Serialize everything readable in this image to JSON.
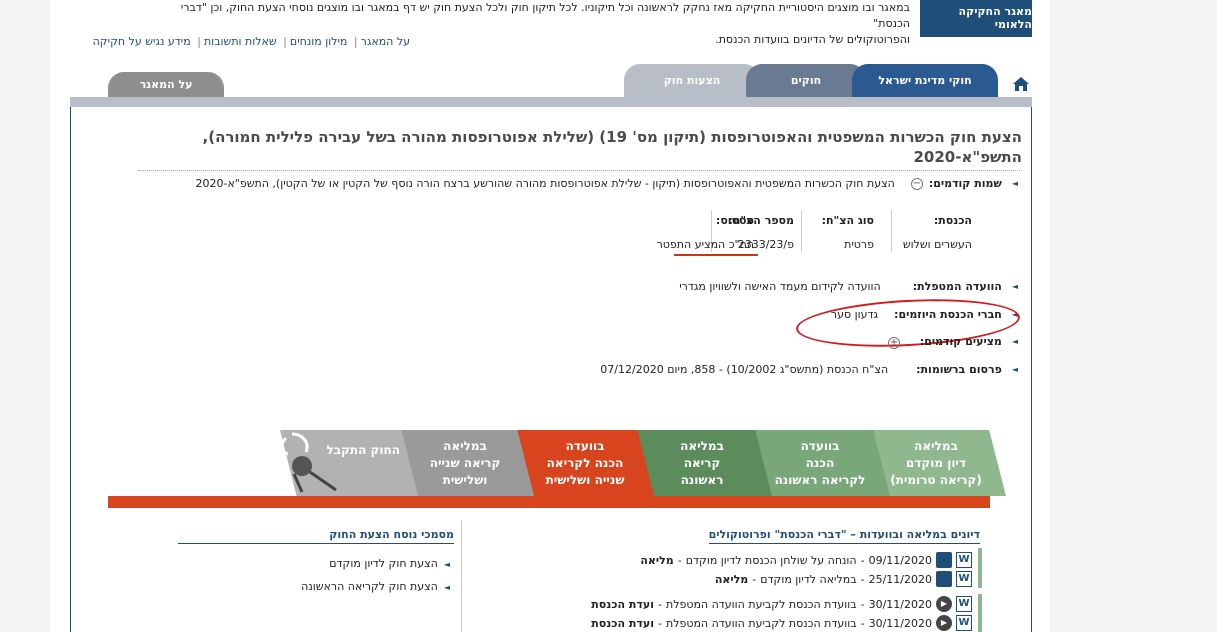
{
  "header": {
    "intro_line1": "במאגר ובו מוצגים היסטוריית החקיקה מאז נחקק לראשונה וכל תיקוניו. לכל תיקון חוק ולכל הצעת חוק יש דף במאגר ובו מוצגים נוסחי הצעת החוק, וכן \"דברי הכנסת\"",
    "intro_line2": "והפרוטוקולים של הדיונים בוועדות הכנסת.",
    "logo_text": "מאגר החקיקה הלאומי",
    "links": [
      "על המאגר",
      "מילון מונחים",
      "שאלות ותשובות",
      "מידע נגיש על חקיקה"
    ]
  },
  "tabs": {
    "laws_state": "חוקי מדינת ישראל",
    "laws": "חוקים",
    "bills": "הצעות חוק",
    "about": "על המאגר"
  },
  "bill": {
    "title_line1": "הצעת חוק הכשרות המשפטית והאפוטרופסות (תיקון מס' 19) (שלילת אפוטרופסות מהורה בשל עבירה פלילית חמורה),",
    "title_line2": "התשפ\"א-2020",
    "prev_names_label": "שמות קודמים:",
    "prev_names_value": "הצעת חוק הכשרות המשפטית והאפוטרופסות (תיקון - שלילת אפוטרופסות מהורה שהורשע ברצח הורה נוסף של הקטין או של הקטין), התשפ\"א-2020",
    "info": {
      "knesset_label": "הכנסת:",
      "knesset_value": "העשרים ושלוש",
      "type_label": "סוג הצ\"ח:",
      "type_value": "פרטית",
      "number_label": "מספר הצ\"ח:",
      "number_value": "פ/2333/23",
      "status_label": "סטטוס:",
      "status_value": "הח\"כ המציע התפטר"
    },
    "committee_label": "הוועדה המטפלת:",
    "committee_value": "הוועדה לקידום מעמד האישה ולשוויון מגדרי",
    "initiators_label": "חברי הכנסת היוזמים:",
    "initiators_value": "גדעון סער",
    "proposers_label": "מציעים קודמים:",
    "publication_label": "פרסום ברשומות:",
    "publication_value": "הצ\"ח הכנסת (מתשס\"ג 10/2002) - 858, מיום 07/12/2020"
  },
  "stages": [
    {
      "line1": "במליאה",
      "line2": "דיון מוקדם",
      "line3": "(קריאה טרומית)"
    },
    {
      "line1": "בוועדה",
      "line2": "הכנה",
      "line3": "לקריאה ראשונה"
    },
    {
      "line1": "במליאה",
      "line2": "קריאה",
      "line3": "ראשונה"
    },
    {
      "line1": "בוועדה",
      "line2": "הכנה לקריאה",
      "line3": "שנייה ושלישית"
    },
    {
      "line1": "במליאה",
      "line2": "קריאה שנייה",
      "line3": "ושלישית"
    },
    {
      "line1": "החוק התקבל",
      "line2": "",
      "line3": ""
    }
  ],
  "discussions": {
    "heading": "דיונים במליאה ובוועדות – \"דברי הכנסת\" ופרוטוקולים",
    "rows": [
      {
        "date": "09/11/2020",
        "text": "הונחה על שולחן הכנסת לדיון מוקדם",
        "place": "מליאה"
      },
      {
        "date": "25/11/2020",
        "text": "במליאה לדיון מוקדם",
        "place": "מליאה"
      },
      {
        "date": "30/11/2020",
        "text": "בוועדת הכנסת לקביעת הוועדה המטפלת",
        "place": "ועדת הכנסת"
      },
      {
        "date": "30/11/2020",
        "text": "בוועדת הכנסת לקביעת הוועדה המטפלת",
        "place": "ועדת הכנסת"
      }
    ]
  },
  "docs": {
    "heading": "מסמכי נוסח הצעת החוק",
    "items": [
      "הצעת חוק לדיון מוקדם",
      "הצעת חוק לקריאה הראשונה"
    ]
  },
  "colors": {
    "brand": "#1f4e79",
    "stage_active": "#d7441e",
    "annotation": "#d41a1a"
  }
}
